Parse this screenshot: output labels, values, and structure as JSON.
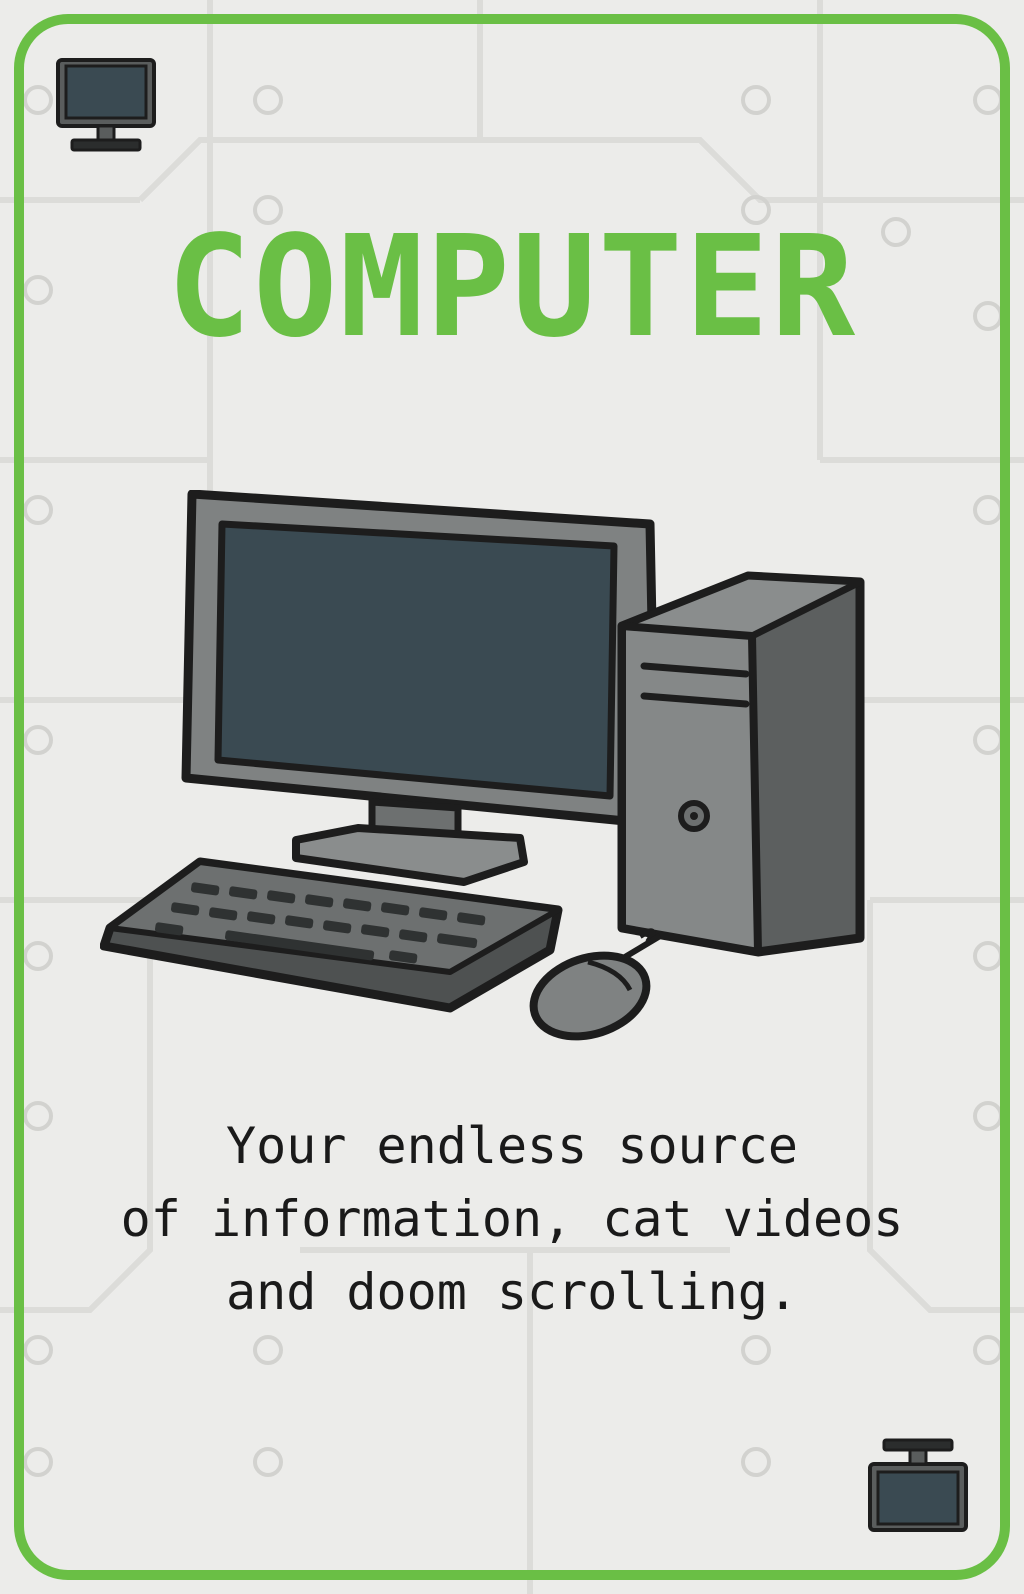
{
  "card": {
    "title": "COMPUTER",
    "description_lines": [
      "Your endless source",
      "of information, cat videos",
      "and doom scrolling."
    ],
    "corner_icon": "monitor-icon",
    "illustration": "desktop-computer-illustration"
  },
  "colors": {
    "accent": "#6abf45",
    "background": "#ececea",
    "text": "#1a1a1a",
    "screen": "#3a4a52",
    "device_gray": "#7a7d7d",
    "outline": "#1d1d1d"
  }
}
